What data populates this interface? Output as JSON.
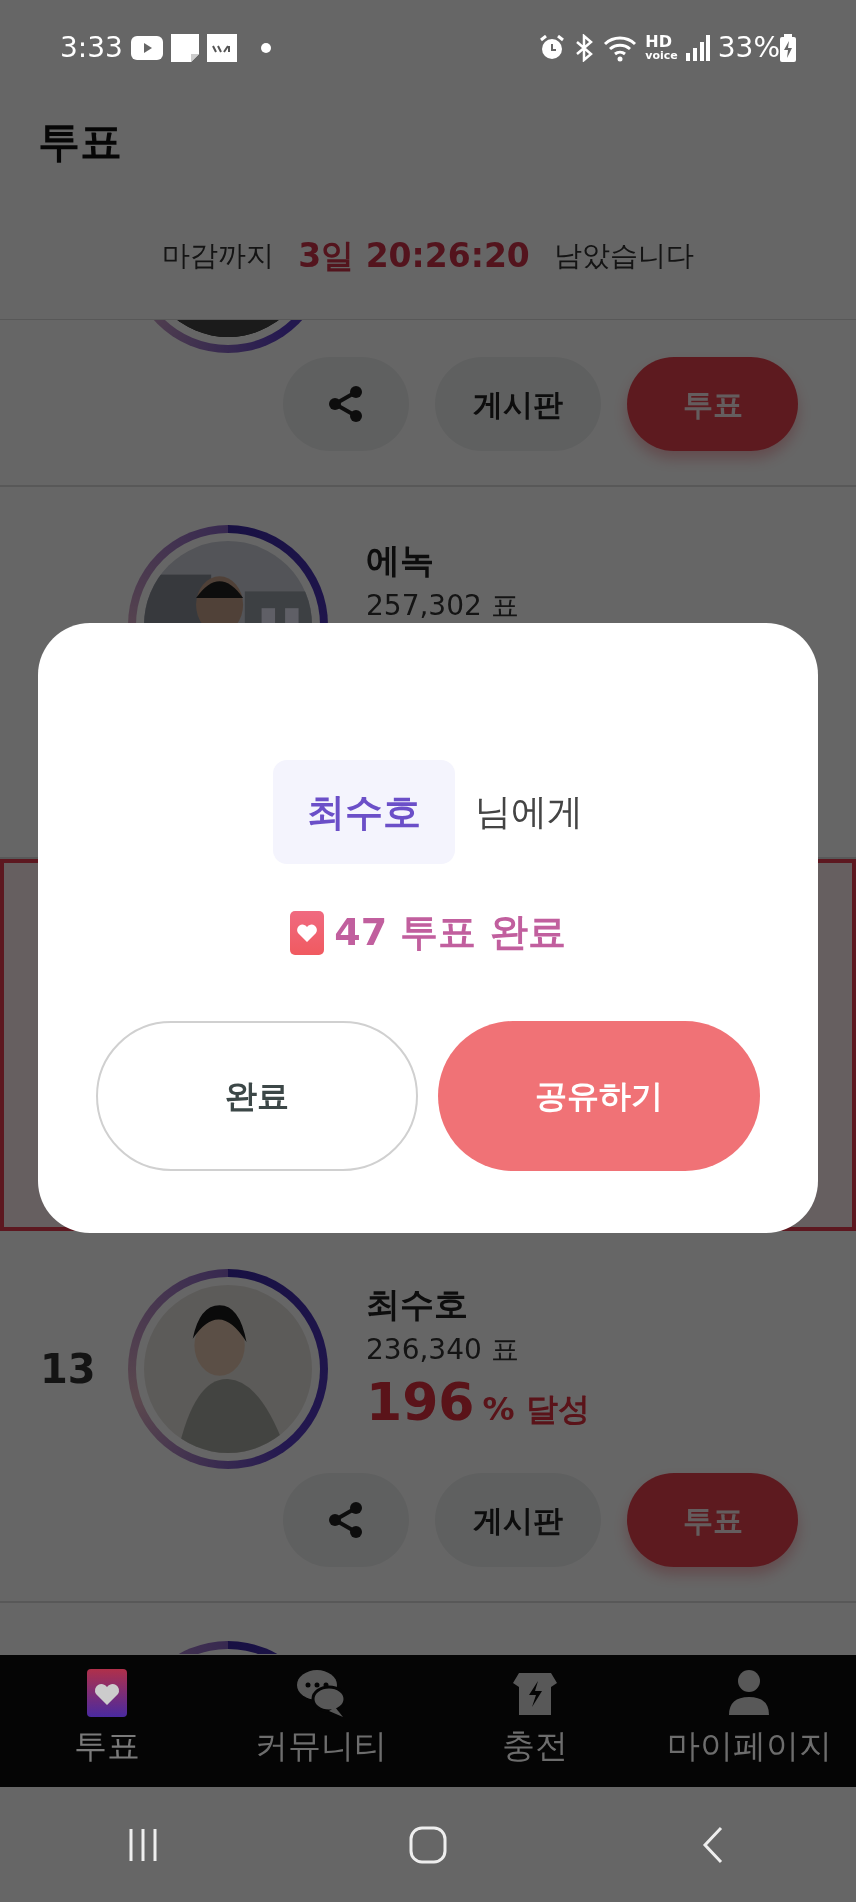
{
  "status_bar": {
    "time": "3:33",
    "hd_label": "HD",
    "voice_label": "voice",
    "battery": "33%"
  },
  "header": {
    "title": "투표"
  },
  "countdown": {
    "prefix": "마감까지",
    "remaining": "3일 20:26:20",
    "suffix": "남았습니다"
  },
  "candidates": [
    {
      "highlighted": false,
      "board_button": "게시판",
      "vote_button": "투표"
    },
    {
      "highlighted": false,
      "name": "에녹",
      "votes": "257,302 표"
    },
    {
      "highlighted": true
    },
    {
      "highlighted": false,
      "rank": "13",
      "name": "최수호",
      "votes": "236,340 표",
      "percent": "196",
      "percent_unit": "% 달성",
      "board_button": "게시판",
      "vote_button": "투표"
    },
    {
      "highlighted": false
    }
  ],
  "dialog": {
    "recipient": "최수호",
    "recipient_suffix": "님에게",
    "result": "47 투표 완료",
    "buttons": [
      {
        "label": "완료",
        "kind": "outline"
      },
      {
        "label": "공유하기",
        "kind": "primary"
      }
    ]
  },
  "bottom_nav": [
    {
      "label": "투표",
      "selected": true
    },
    {
      "label": "커뮤니티",
      "selected": false
    },
    {
      "label": "충전",
      "selected": false
    },
    {
      "label": "마이페이지",
      "selected": false
    }
  ]
}
